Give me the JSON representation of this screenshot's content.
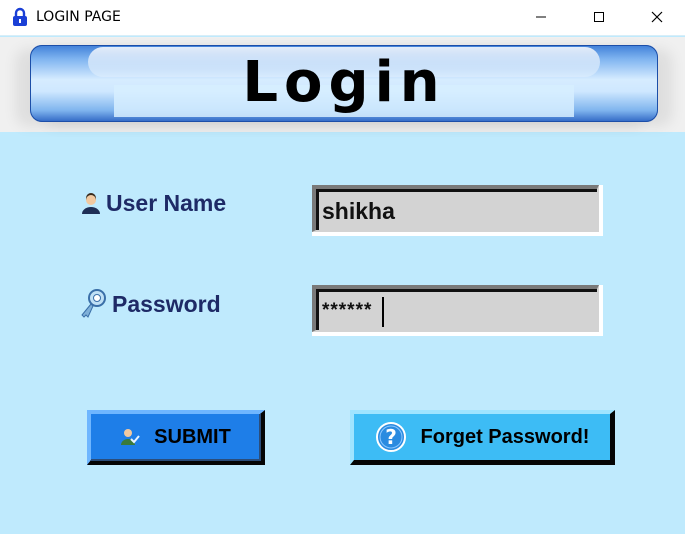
{
  "window": {
    "title": "LOGIN PAGE",
    "controls": {
      "minimize": "minimize-icon",
      "maximize": "maximize-icon",
      "close": "close-icon"
    }
  },
  "banner": {
    "title": "Login"
  },
  "form": {
    "username": {
      "label": "User Name",
      "value": "shikha",
      "icon": "user-icon"
    },
    "password": {
      "label": "Password",
      "value": "******",
      "icon": "key-icon"
    }
  },
  "buttons": {
    "submit": {
      "label": "SUBMIT",
      "icon": "user-check-icon"
    },
    "forget": {
      "label": "Forget Password!",
      "icon": "question-icon"
    }
  },
  "colors": {
    "background": "#bfeafd",
    "label": "#1e2a66",
    "submit": "#1e7ee8",
    "forget": "#3dbcf5"
  }
}
